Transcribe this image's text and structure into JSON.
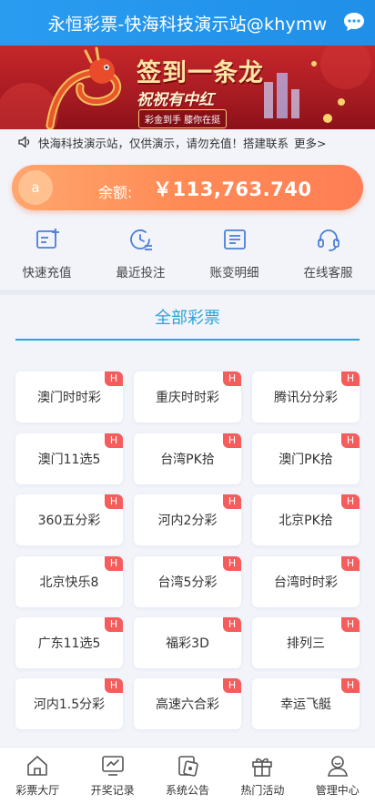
{
  "header": {
    "title": "永恒彩票-快海科技演示站@khymw"
  },
  "banner": {
    "slogan1": "签到一条龙",
    "slogan2": "祝祝有中红",
    "tag": "彩金到手 膝你在挺"
  },
  "notice": {
    "text": "快海科技演示站，仅供演示，请勿充值！搭建联系",
    "more": "更多>"
  },
  "balance": {
    "avatar": "a",
    "label": "余额:",
    "amount": "￥113,763.740"
  },
  "quick_actions": [
    {
      "label": "快速充值",
      "icon": "recharge-icon"
    },
    {
      "label": "最近投注",
      "icon": "recent-bets-icon"
    },
    {
      "label": "账变明细",
      "icon": "account-details-icon"
    },
    {
      "label": "在线客服",
      "icon": "customer-service-icon"
    }
  ],
  "section": {
    "title": "全部彩票"
  },
  "lotteries": [
    {
      "name": "澳门时时彩",
      "badge": "H"
    },
    {
      "name": "重庆时时彩",
      "badge": "H"
    },
    {
      "name": "腾讯分分彩",
      "badge": "H"
    },
    {
      "name": "澳门11选5",
      "badge": "H"
    },
    {
      "name": "台湾PK拾",
      "badge": "H"
    },
    {
      "name": "澳门PK拾",
      "badge": "H"
    },
    {
      "name": "360五分彩",
      "badge": "H"
    },
    {
      "name": "河内2分彩",
      "badge": "H"
    },
    {
      "name": "北京PK拾",
      "badge": "H"
    },
    {
      "name": "北京快乐8",
      "badge": "H"
    },
    {
      "name": "台湾5分彩",
      "badge": "H"
    },
    {
      "name": "台湾时时彩",
      "badge": "H"
    },
    {
      "name": "广东11选5",
      "badge": "H"
    },
    {
      "name": "福彩3D",
      "badge": "H"
    },
    {
      "name": "排列三",
      "badge": "H"
    },
    {
      "name": "河内1.5分彩",
      "badge": "H"
    },
    {
      "name": "高速六合彩",
      "badge": "H"
    },
    {
      "name": "幸运飞艇",
      "badge": "H"
    }
  ],
  "tabbar": [
    {
      "label": "彩票大厅",
      "icon": "home-icon"
    },
    {
      "label": "开奖记录",
      "icon": "draw-results-icon"
    },
    {
      "label": "系统公告",
      "icon": "announcement-icon"
    },
    {
      "label": "热门活动",
      "icon": "gift-icon"
    },
    {
      "label": "管理中心",
      "icon": "user-center-icon"
    }
  ],
  "colors": {
    "primary": "#2aa3dd",
    "header": "#2a9cf0",
    "balance_start": "#ffa66e",
    "balance_end": "#ff7e55",
    "hot_badge": "#f55d5d",
    "icon": "#4b7fd6"
  }
}
